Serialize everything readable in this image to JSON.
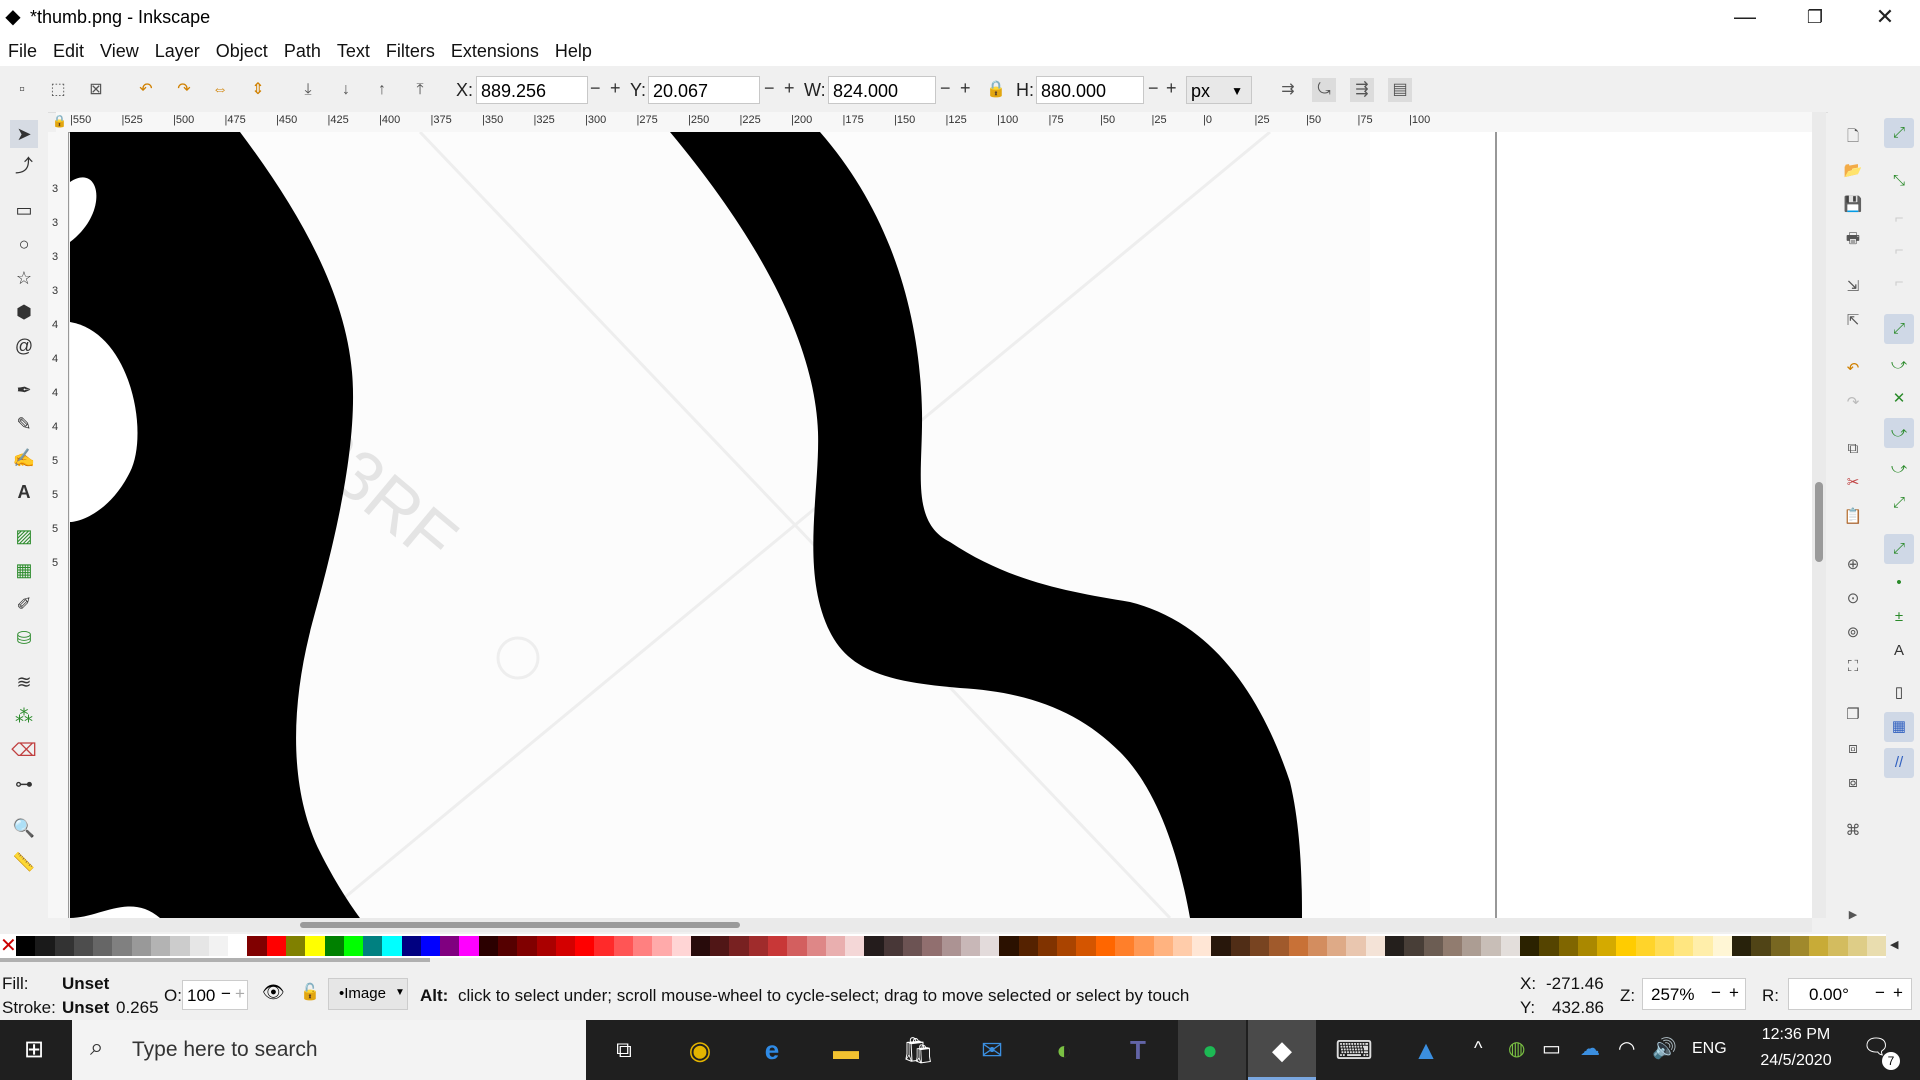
{
  "window": {
    "title": "*thumb.png - Inkscape",
    "minimize_glyph": "—",
    "restore_glyph": "❐",
    "close_glyph": "✕"
  },
  "menu": [
    "File",
    "Edit",
    "View",
    "Layer",
    "Object",
    "Path",
    "Text",
    "Filters",
    "Extensions",
    "Help"
  ],
  "toolbar": {
    "x_label": "X:",
    "x_value": "889.256",
    "y_label": "Y:",
    "y_value": "20.067",
    "w_label": "W:",
    "w_value": "824.000",
    "h_label": "H:",
    "h_value": "880.000",
    "unit": "px",
    "minus": "−",
    "plus": "+"
  },
  "ruler": {
    "h_ticks": [
      "|550",
      "|525",
      "|500",
      "|475",
      "|450",
      "|425",
      "|400",
      "|375",
      "|350",
      "|325",
      "|300",
      "|275",
      "|250",
      "|225",
      "|200",
      "|175",
      "|150",
      "|125",
      "|100",
      "|75",
      "|50",
      "|25",
      "|0",
      "|25",
      "|50",
      "|75",
      "|100"
    ],
    "v_ticks": [
      "3",
      "3",
      "3",
      "3",
      "4",
      "4",
      "4",
      "4",
      "5",
      "5",
      "5",
      "5"
    ]
  },
  "canvas": {
    "watermark_text": "123RF"
  },
  "palette": [
    "#000000",
    "#1a1a1a",
    "#333333",
    "#4d4d4d",
    "#666666",
    "#808080",
    "#999999",
    "#b3b3b3",
    "#cccccc",
    "#e6e6e6",
    "#f2f2f2",
    "#ffffff",
    "#800000",
    "#ff0000",
    "#808000",
    "#ffff00",
    "#008000",
    "#00ff00",
    "#008080",
    "#00ffff",
    "#000080",
    "#0000ff",
    "#800080",
    "#ff00ff",
    "#2b0000",
    "#550000",
    "#800000",
    "#aa0000",
    "#d40000",
    "#ff0000",
    "#ff2a2a",
    "#ff5555",
    "#ff8080",
    "#ffaaaa",
    "#ffd5d5",
    "#280b0b",
    "#501616",
    "#782121",
    "#a02c2c",
    "#c83737",
    "#d35f5f",
    "#de8787",
    "#e9afaf",
    "#f4d7d7",
    "#241c1c",
    "#483737",
    "#6c5353",
    "#916f6f",
    "#ac9393",
    "#c8b7b7",
    "#e3dbdb",
    "#2b1100",
    "#552200",
    "#803300",
    "#aa4400",
    "#d45500",
    "#ff6600",
    "#ff7f2a",
    "#ff9955",
    "#ffb380",
    "#ffccaa",
    "#ffe6d5",
    "#28170b",
    "#502d16",
    "#784421",
    "#a05a2c",
    "#c87137",
    "#d38d5f",
    "#deaa87",
    "#e9c6af",
    "#f4e3d7",
    "#241f1c",
    "#483e37",
    "#6c5d53",
    "#917c6f",
    "#ac9d93",
    "#c8beb7",
    "#e3dedb",
    "#2b2200",
    "#554400",
    "#806600",
    "#aa8800",
    "#d4aa00",
    "#ffcc00",
    "#ffd42a",
    "#ffdd55",
    "#ffe680",
    "#ffeeaa",
    "#fff6d5",
    "#28220b",
    "#504416",
    "#786721",
    "#a0892c",
    "#c8ab37",
    "#d3bc5f",
    "#decd87",
    "#e9ddaf"
  ],
  "status": {
    "fill_label": "Fill:",
    "fill_value": "Unset",
    "stroke_label": "Stroke:",
    "stroke_value": "Unset",
    "stroke_width": "0.265",
    "opacity_label": "O:",
    "opacity_value": "100",
    "layer_value": "•Image",
    "hint_bold": "Alt:",
    "hint": "click to select under; scroll mouse-wheel to cycle-select; drag to move selected or select by touch",
    "cursor_x_label": "X:",
    "cursor_x": "-271.46",
    "cursor_y_label": "Y:",
    "cursor_y": "432.86",
    "zoom_label": "Z:",
    "zoom": "257%",
    "rotate_label": "R:",
    "rotate": "0.00°"
  },
  "taskbar": {
    "search_placeholder": "Type here to search",
    "lang": "ENG",
    "time": "12:36 PM",
    "date": "24/5/2020",
    "notifications": "7"
  }
}
